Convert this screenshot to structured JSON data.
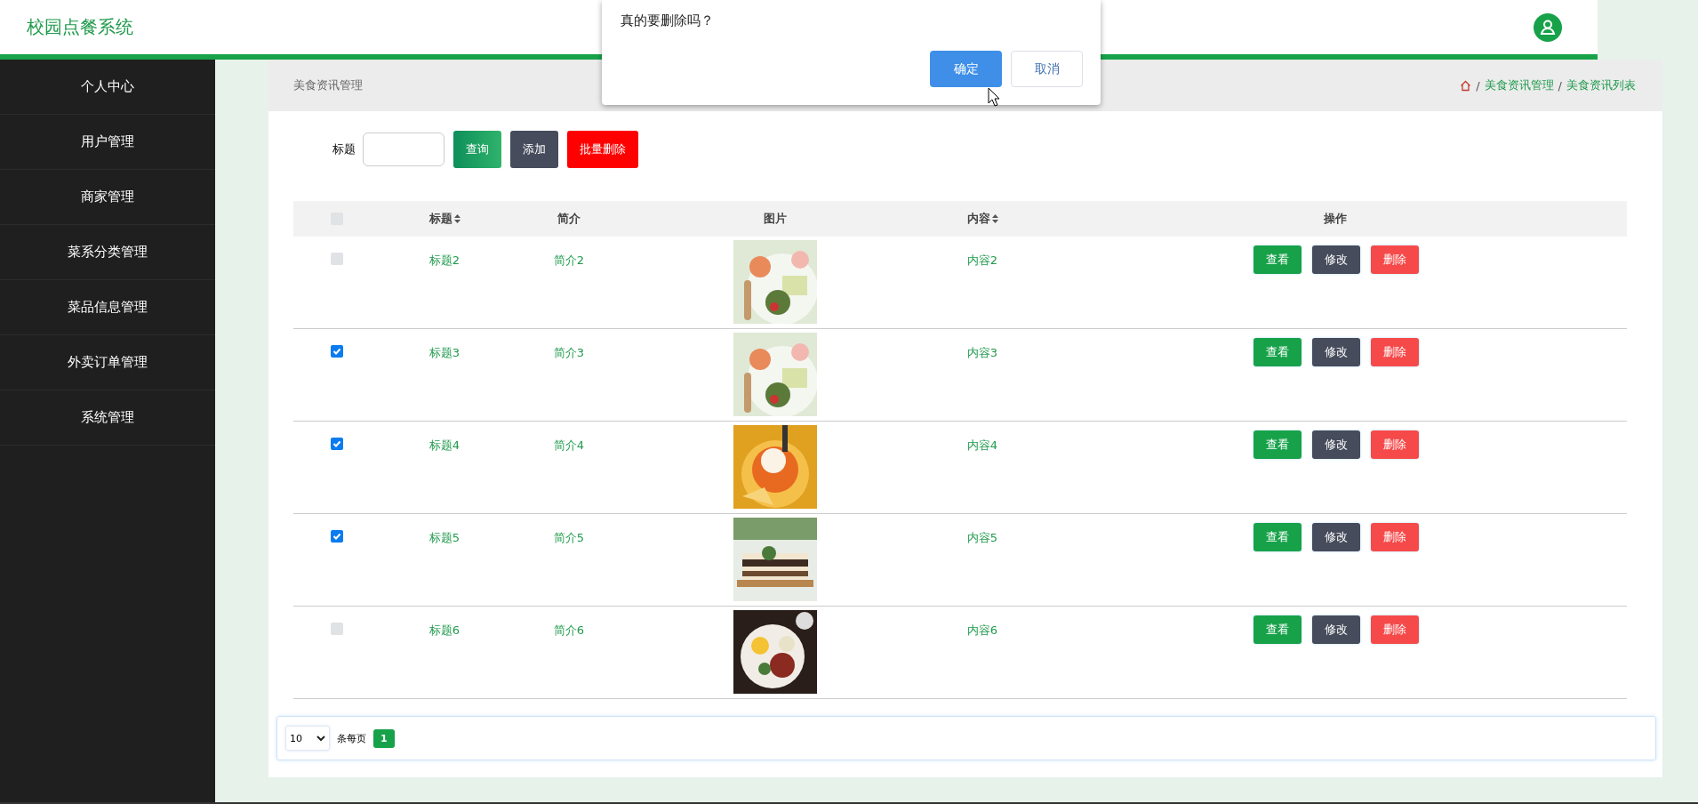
{
  "header": {
    "title": "校园点餐系统"
  },
  "sidebar": {
    "items": [
      {
        "label": "个人中心"
      },
      {
        "label": "用户管理"
      },
      {
        "label": "商家管理"
      },
      {
        "label": "菜系分类管理"
      },
      {
        "label": "菜品信息管理"
      },
      {
        "label": "外卖订单管理"
      },
      {
        "label": "系统管理"
      }
    ]
  },
  "page": {
    "title": "美食资讯管理",
    "breadcrumb": [
      {
        "separator": "/",
        "label": "美食资讯管理"
      },
      {
        "separator": "/",
        "label": "美食资讯列表"
      }
    ]
  },
  "search": {
    "label": "标题",
    "buttons": [
      {
        "label": "查询",
        "kind": "search"
      },
      {
        "label": "添加",
        "kind": "add"
      },
      {
        "label": "批量删除",
        "kind": "danger"
      }
    ]
  },
  "table": {
    "columns": [
      {
        "kind": "checkbox",
        "checked": false
      },
      {
        "kind": "text",
        "label": "标题",
        "sortable": true
      },
      {
        "kind": "text",
        "label": "简介",
        "sortable": false
      },
      {
        "kind": "text",
        "label": "图片",
        "sortable": false
      },
      {
        "kind": "text",
        "label": "内容",
        "sortable": true
      },
      {
        "kind": "text",
        "label": "操作",
        "sortable": false
      }
    ],
    "rows": [
      {
        "checked": false,
        "title": "标题2",
        "intro": "简介2",
        "content": "内容2",
        "actions": [
          {
            "label": "查看",
            "kind": "view"
          },
          {
            "label": "修改",
            "kind": "edit"
          },
          {
            "label": "删除",
            "kind": "delete"
          }
        ]
      },
      {
        "checked": true,
        "title": "标题3",
        "intro": "简介3",
        "content": "内容3",
        "actions": [
          {
            "label": "查看",
            "kind": "view"
          },
          {
            "label": "修改",
            "kind": "edit"
          },
          {
            "label": "删除",
            "kind": "delete"
          }
        ]
      },
      {
        "checked": true,
        "title": "标题4",
        "intro": "简介4",
        "content": "内容4",
        "actions": [
          {
            "label": "查看",
            "kind": "view"
          },
          {
            "label": "修改",
            "kind": "edit"
          },
          {
            "label": "删除",
            "kind": "delete"
          }
        ]
      },
      {
        "checked": true,
        "title": "标题5",
        "intro": "简介5",
        "content": "内容5",
        "actions": [
          {
            "label": "查看",
            "kind": "view"
          },
          {
            "label": "修改",
            "kind": "edit"
          },
          {
            "label": "删除",
            "kind": "delete"
          }
        ]
      },
      {
        "checked": false,
        "title": "标题6",
        "intro": "简介6",
        "content": "内容6",
        "actions": [
          {
            "label": "查看",
            "kind": "view"
          },
          {
            "label": "修改",
            "kind": "edit"
          },
          {
            "label": "删除",
            "kind": "delete"
          }
        ]
      }
    ]
  },
  "pagination": {
    "page_size": "10",
    "label": "条每页",
    "pages": [
      {
        "label": "1",
        "selected": true
      }
    ]
  },
  "dialog": {
    "message": "真的要删除吗？",
    "buttons": [
      {
        "label": "确定",
        "kind": "primary"
      },
      {
        "label": "取消",
        "kind": "default"
      }
    ]
  }
}
